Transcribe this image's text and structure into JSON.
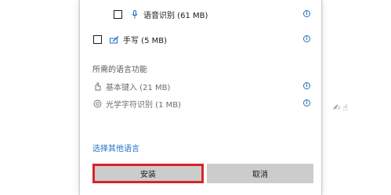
{
  "features": {
    "speech": {
      "label": "语音识别 (61 MB)",
      "icon": "microphone-icon",
      "checked": false
    },
    "handwriting": {
      "label": "手写 (5 MB)",
      "icon": "pen-icon",
      "checked": false
    }
  },
  "required_section": {
    "title": "所需的语言功能",
    "items": [
      {
        "label": "基本键入 (21 MB)",
        "icon": "typing-hand-icon"
      },
      {
        "label": "光学字符识别 (1 MB)",
        "icon": "ocr-eye-icon"
      }
    ]
  },
  "links": {
    "choose_other_language": "选择其他语言"
  },
  "buttons": {
    "install": "安装",
    "cancel": "取消"
  },
  "colors": {
    "accent": "#1f6fc8",
    "highlight": "#d8232a",
    "button_bg": "#cccccc"
  }
}
